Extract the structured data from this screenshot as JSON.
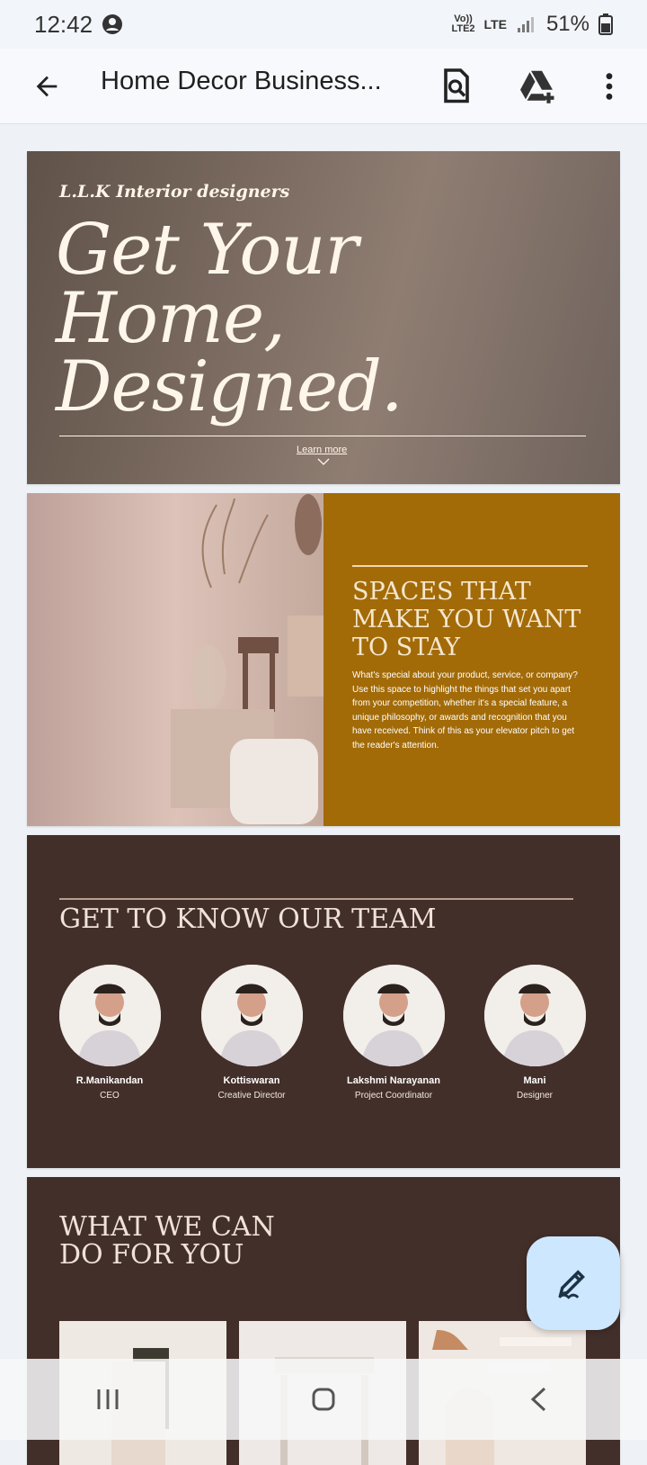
{
  "status_bar": {
    "time": "12:42",
    "carrier_top": "Vo))",
    "carrier_bottom": "LTE2",
    "network": "LTE",
    "battery": "51%"
  },
  "app_bar": {
    "title": "Home Decor Business..."
  },
  "icons": {
    "back": "back-arrow-icon",
    "search": "document-search-icon",
    "drive": "drive-add-icon",
    "more": "more-vert-icon",
    "edit": "edit-pencil-icon"
  },
  "slides": {
    "hero": {
      "brand": "L.L.K Interior designers",
      "title_line1": "Get Your Home,",
      "title_line2": "Designed.",
      "link": "Learn more"
    },
    "spaces": {
      "title_line1": "SPACES THAT",
      "title_line2": "MAKE YOU WANT",
      "title_line3": "TO STAY",
      "body": "What's special about your product, service, or company? Use this space to highlight the things that set you apart from your competition, whether it's a special feature, a unique philosophy, or awards and recognition that you have received. Think of this as your elevator pitch to get the reader's attention."
    },
    "team": {
      "title": "GET TO KNOW OUR TEAM",
      "members": [
        {
          "name": "R.Manikandan",
          "role": "CEO"
        },
        {
          "name": "Kottiswaran",
          "role": "Creative Director"
        },
        {
          "name": "Lakshmi Narayanan",
          "role": "Project Coordinator"
        },
        {
          "name": "Mani",
          "role": "Designer"
        }
      ]
    },
    "services": {
      "title_line1": "WHAT WE CAN",
      "title_line2": "DO FOR YOU"
    }
  },
  "system_nav": {
    "recent": "recent-apps-icon",
    "home": "home-icon",
    "back": "system-back-icon"
  }
}
